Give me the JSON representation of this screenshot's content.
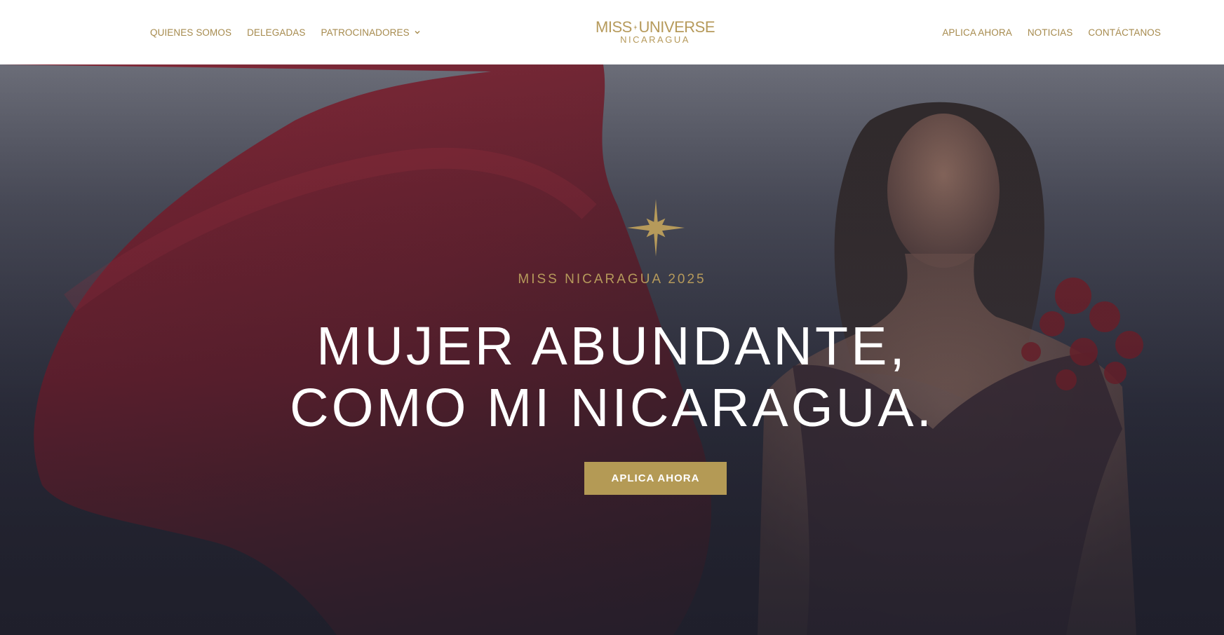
{
  "colors": {
    "gold": "#b69a5b",
    "button": "#b49a55",
    "header_bg": "#ffffff"
  },
  "nav_left": [
    {
      "label": "QUIENES SOMOS"
    },
    {
      "label": "DELEGADAS"
    },
    {
      "label": "PATROCINADORES",
      "icon": "chevron-down-icon"
    }
  ],
  "logo": {
    "top": "MISS",
    "top2": "UNIVERSE",
    "bottom": "NICARAGUA",
    "icon": "star-icon"
  },
  "nav_right": [
    {
      "label": "APLICA AHORA"
    },
    {
      "label": "NOTICIAS"
    },
    {
      "label": "CONTÁCTANOS"
    }
  ],
  "hero": {
    "eyebrow": "MISS NICARAGUA 2025",
    "title_line1": "MUJER ABUNDANTE,",
    "title_line2": "COMO MI NICARAGUA.",
    "cta": "APLICA AHORA",
    "icon": "star-icon"
  }
}
